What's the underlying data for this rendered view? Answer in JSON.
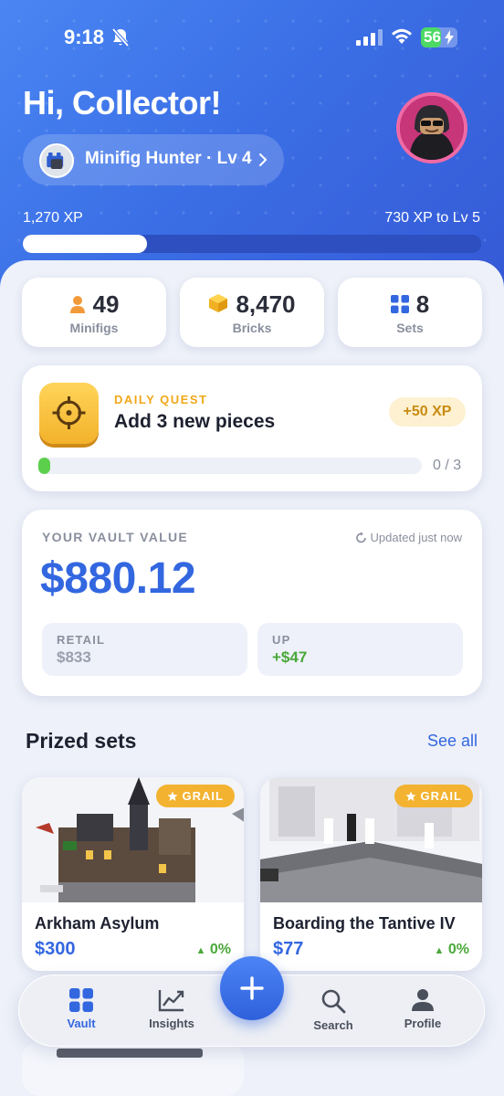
{
  "status_bar": {
    "time": "9:18",
    "battery": "56",
    "battery_level": 0.56
  },
  "header": {
    "greeting": "Hi, Collector!",
    "rank_label": "Minifig Hunter · Lv 4",
    "xp_current": "1,270 XP",
    "xp_to_next": "730 XP to Lv 5",
    "xp_progress": 0.27
  },
  "stats": [
    {
      "value": "49",
      "label": "Minifigs",
      "icon": "person-icon"
    },
    {
      "value": "8,470",
      "label": "Bricks",
      "icon": "cube-icon"
    },
    {
      "value": "8",
      "label": "Sets",
      "icon": "grid-icon"
    }
  ],
  "quest": {
    "kicker": "DAILY QUEST",
    "title": "Add 3 new pieces",
    "reward": "+50 XP",
    "progress_text": "0 / 3",
    "progress": 0.03
  },
  "vault": {
    "kicker": "YOUR VAULT VALUE",
    "updated": "Updated just now",
    "value": "$880.12",
    "retail_label": "RETAIL",
    "retail_value": "$833",
    "up_label": "UP",
    "up_value": "+$47"
  },
  "prized": {
    "title": "Prized sets",
    "see_all": "See all",
    "sets": [
      {
        "badge": "GRAIL",
        "name": "Arkham Asylum",
        "price": "$300",
        "change": "0%"
      },
      {
        "badge": "GRAIL",
        "name": "Boarding the Tantive IV",
        "price": "$77",
        "change": "0%"
      }
    ]
  },
  "tabbar": {
    "tabs": [
      {
        "label": "Vault",
        "icon": "grid-icon",
        "active": true
      },
      {
        "label": "Insights",
        "icon": "chart-icon",
        "active": false
      },
      {
        "label": "Search",
        "icon": "search-icon",
        "active": false
      },
      {
        "label": "Profile",
        "icon": "profile-icon",
        "active": false
      }
    ],
    "fab_icon": "plus-icon"
  },
  "colors": {
    "accent": "#3367e0",
    "gold": "#f3b330",
    "green": "#4aa83a"
  }
}
